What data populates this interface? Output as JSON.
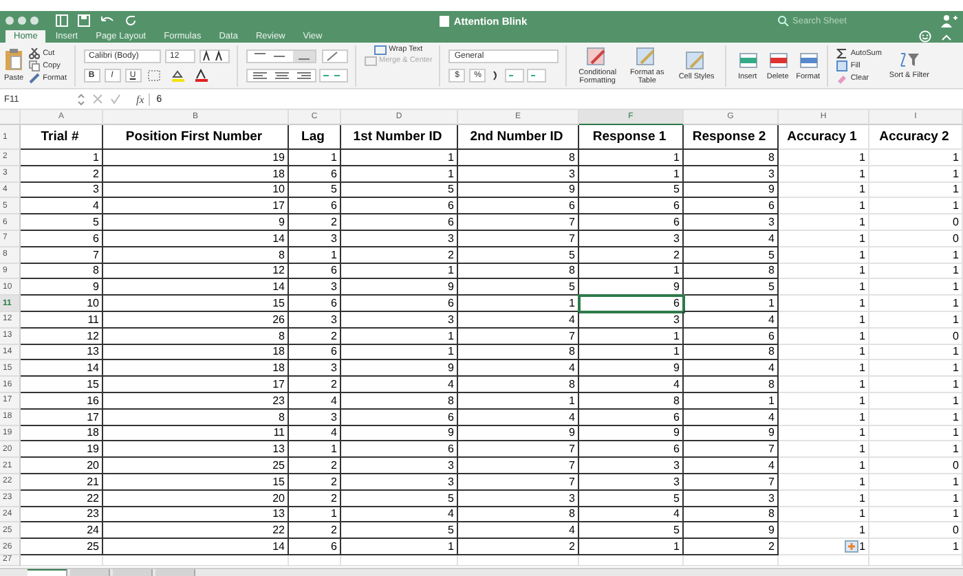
{
  "window": {
    "title": "Attention Blink",
    "search_placeholder": "Search Sheet"
  },
  "ribbon_tabs": [
    {
      "label": "Home",
      "selected": true
    },
    {
      "label": "Insert",
      "selected": false
    },
    {
      "label": "Page Layout",
      "selected": false
    },
    {
      "label": "Formulas",
      "selected": false
    },
    {
      "label": "Data",
      "selected": false
    },
    {
      "label": "Review",
      "selected": false
    },
    {
      "label": "View",
      "selected": false
    }
  ],
  "clipboard": {
    "paste": "Paste",
    "small": [
      "Cut",
      "Copy",
      "Format"
    ]
  },
  "font": {
    "family": "Calibri (Body)",
    "size": "12",
    "styles": [
      "B",
      "I",
      "U"
    ]
  },
  "alignment": [
    {
      "label": "Wrap Text",
      "disabled": false
    },
    {
      "label": "Merge & Center",
      "disabled": true
    }
  ],
  "number": {
    "format": "General",
    "symbols": [
      "$",
      "%"
    ]
  },
  "styles": [
    "Conditional Formatting",
    "Format as Table",
    "Cell Styles"
  ],
  "cells": [
    "Insert",
    "Delete",
    "Format"
  ],
  "editing": {
    "small": [
      "AutoSum",
      "Fill",
      "Clear"
    ],
    "sort": "Sort & Filter"
  },
  "formula_bar": {
    "name_box": "F11",
    "fx": "fx",
    "value": "6"
  },
  "columns": [
    {
      "letter": "A",
      "selected": false
    },
    {
      "letter": "B",
      "selected": false
    },
    {
      "letter": "C",
      "selected": false
    },
    {
      "letter": "D",
      "selected": false
    },
    {
      "letter": "E",
      "selected": false
    },
    {
      "letter": "F",
      "selected": true
    },
    {
      "letter": "G",
      "selected": false
    },
    {
      "letter": "H",
      "selected": false
    },
    {
      "letter": "I",
      "selected": false
    }
  ],
  "header_row": {
    "number": "1",
    "cells": [
      "Trial #",
      "Position First Number",
      "Lag",
      "1st Number ID",
      "2nd Number ID",
      "Response 1",
      "Response 2",
      "Accuracy 1",
      "Accuracy 2"
    ]
  },
  "rows": [
    {
      "number": "2",
      "selected": false,
      "paste_options": false,
      "cells": [
        "1",
        "19",
        "1",
        "1",
        "8",
        "1",
        "8",
        "1",
        "1"
      ]
    },
    {
      "number": "3",
      "selected": false,
      "paste_options": false,
      "cells": [
        "2",
        "18",
        "6",
        "1",
        "3",
        "1",
        "3",
        "1",
        "1"
      ]
    },
    {
      "number": "4",
      "selected": false,
      "paste_options": false,
      "cells": [
        "3",
        "10",
        "5",
        "5",
        "9",
        "5",
        "9",
        "1",
        "1"
      ]
    },
    {
      "number": "5",
      "selected": false,
      "paste_options": false,
      "cells": [
        "4",
        "17",
        "6",
        "6",
        "6",
        "6",
        "6",
        "1",
        "1"
      ]
    },
    {
      "number": "6",
      "selected": false,
      "paste_options": false,
      "cells": [
        "5",
        "9",
        "2",
        "6",
        "7",
        "6",
        "3",
        "1",
        "0"
      ]
    },
    {
      "number": "7",
      "selected": false,
      "paste_options": false,
      "cells": [
        "6",
        "14",
        "3",
        "3",
        "7",
        "3",
        "4",
        "1",
        "0"
      ]
    },
    {
      "number": "8",
      "selected": false,
      "paste_options": false,
      "cells": [
        "7",
        "8",
        "1",
        "2",
        "5",
        "2",
        "5",
        "1",
        "1"
      ]
    },
    {
      "number": "9",
      "selected": false,
      "paste_options": false,
      "cells": [
        "8",
        "12",
        "6",
        "1",
        "8",
        "1",
        "8",
        "1",
        "1"
      ]
    },
    {
      "number": "10",
      "selected": false,
      "paste_options": false,
      "cells": [
        "9",
        "14",
        "3",
        "9",
        "5",
        "9",
        "5",
        "1",
        "1"
      ]
    },
    {
      "number": "11",
      "selected": true,
      "paste_options": false,
      "cells": [
        "10",
        "15",
        "6",
        "6",
        "1",
        "6",
        "1",
        "1",
        "1"
      ]
    },
    {
      "number": "12",
      "selected": false,
      "paste_options": false,
      "cells": [
        "11",
        "26",
        "3",
        "3",
        "4",
        "3",
        "4",
        "1",
        "1"
      ]
    },
    {
      "number": "13",
      "selected": false,
      "paste_options": false,
      "cells": [
        "12",
        "8",
        "2",
        "1",
        "7",
        "1",
        "6",
        "1",
        "0"
      ]
    },
    {
      "number": "14",
      "selected": false,
      "paste_options": false,
      "cells": [
        "13",
        "18",
        "6",
        "1",
        "8",
        "1",
        "8",
        "1",
        "1"
      ]
    },
    {
      "number": "15",
      "selected": false,
      "paste_options": false,
      "cells": [
        "14",
        "18",
        "3",
        "9",
        "4",
        "9",
        "4",
        "1",
        "1"
      ]
    },
    {
      "number": "16",
      "selected": false,
      "paste_options": false,
      "cells": [
        "15",
        "17",
        "2",
        "4",
        "8",
        "4",
        "8",
        "1",
        "1"
      ]
    },
    {
      "number": "17",
      "selected": false,
      "paste_options": false,
      "cells": [
        "16",
        "23",
        "4",
        "8",
        "1",
        "8",
        "1",
        "1",
        "1"
      ]
    },
    {
      "number": "18",
      "selected": false,
      "paste_options": false,
      "cells": [
        "17",
        "8",
        "3",
        "6",
        "4",
        "6",
        "4",
        "1",
        "1"
      ]
    },
    {
      "number": "19",
      "selected": false,
      "paste_options": false,
      "cells": [
        "18",
        "11",
        "4",
        "9",
        "9",
        "9",
        "9",
        "1",
        "1"
      ]
    },
    {
      "number": "20",
      "selected": false,
      "paste_options": false,
      "cells": [
        "19",
        "13",
        "1",
        "6",
        "7",
        "6",
        "7",
        "1",
        "1"
      ]
    },
    {
      "number": "21",
      "selected": false,
      "paste_options": false,
      "cells": [
        "20",
        "25",
        "2",
        "3",
        "7",
        "3",
        "4",
        "1",
        "0"
      ]
    },
    {
      "number": "22",
      "selected": false,
      "paste_options": false,
      "cells": [
        "21",
        "15",
        "2",
        "3",
        "7",
        "3",
        "7",
        "1",
        "1"
      ]
    },
    {
      "number": "23",
      "selected": false,
      "paste_options": false,
      "cells": [
        "22",
        "20",
        "2",
        "5",
        "3",
        "5",
        "3",
        "1",
        "1"
      ]
    },
    {
      "number": "24",
      "selected": false,
      "paste_options": false,
      "cells": [
        "23",
        "13",
        "1",
        "4",
        "8",
        "4",
        "8",
        "1",
        "1"
      ]
    },
    {
      "number": "25",
      "selected": false,
      "paste_options": false,
      "cells": [
        "24",
        "22",
        "2",
        "5",
        "4",
        "5",
        "9",
        "1",
        "0"
      ]
    },
    {
      "number": "26",
      "selected": false,
      "paste_options": true,
      "cells": [
        "25",
        "14",
        "6",
        "1",
        "2",
        "1",
        "2",
        "1",
        "1"
      ]
    }
  ],
  "partial_row": {
    "number": "27"
  },
  "sheet_tabs": [
    {
      "selected": true
    },
    {
      "selected": false
    },
    {
      "selected": false
    },
    {
      "selected": false
    }
  ]
}
